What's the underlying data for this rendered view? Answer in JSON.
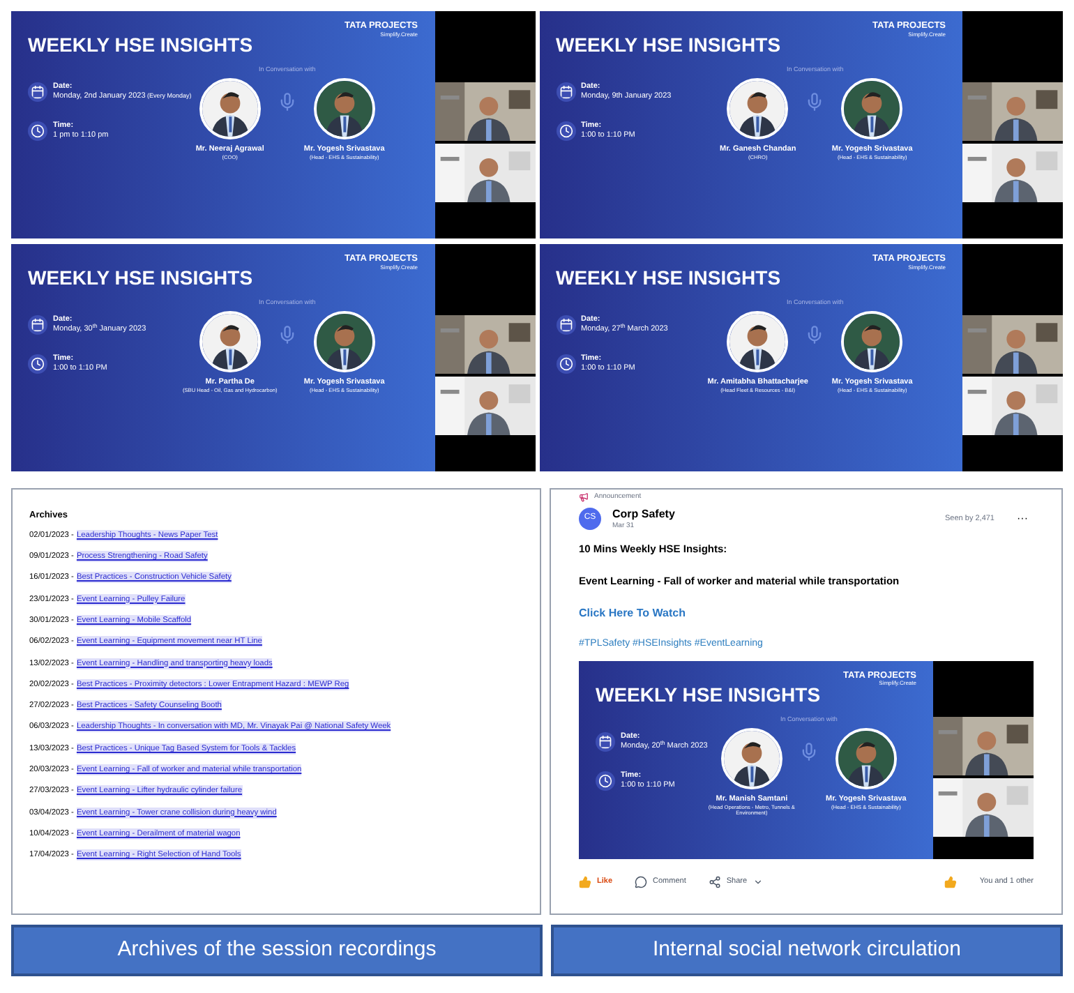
{
  "slides": [
    {
      "title": "WEEKLY HSE INSIGHTS",
      "logo": "TATA PROJECTS",
      "tagline": "Simplify.Create",
      "intro": "In Conversation with",
      "date_label": "Date:",
      "date": "Monday, 2nd January 2023",
      "date_note": "(Every Monday)",
      "time_label": "Time:",
      "time": "1 pm to 1:10 pm",
      "guests": [
        {
          "name": "Mr. Neeraj Agrawal",
          "role": "(COO)"
        },
        {
          "name": "Mr. Yogesh Srivastava",
          "role": "(Head - EHS & Sustainability)"
        }
      ]
    },
    {
      "title": "WEEKLY HSE INSIGHTS",
      "logo": "TATA PROJECTS",
      "tagline": "Simplify.Create",
      "intro": "In Conversation with",
      "date_label": "Date:",
      "date": "Monday, 9th January 2023",
      "time_label": "Time:",
      "time": "1:00 to 1:10 PM",
      "guests": [
        {
          "name": "Mr. Ganesh Chandan",
          "role": "(CHRO)"
        },
        {
          "name": "Mr. Yogesh Srivastava",
          "role": "(Head - EHS & Sustainability)"
        }
      ]
    },
    {
      "title": "WEEKLY HSE INSIGHTS",
      "logo": "TATA PROJECTS",
      "tagline": "Simplify.Create",
      "intro": "In Conversation with",
      "date_label": "Date:",
      "date": "Monday, 30$^{th}$ January 2023",
      "time_label": "Time:",
      "time": "1:00 to 1:10 PM",
      "guests": [
        {
          "name": "Mr. Partha De",
          "role": "(SBU Head - Oil, Gas and Hydrocarbon)"
        },
        {
          "name": "Mr. Yogesh Srivastava",
          "role": "(Head - EHS & Sustainability)"
        }
      ]
    },
    {
      "title": "WEEKLY HSE INSIGHTS",
      "logo": "TATA PROJECTS",
      "tagline": "Simplify.Create",
      "intro": "In Conversation with",
      "date_label": "Date:",
      "date": "Monday, 27$^{th}$ March 2023",
      "time_label": "Time:",
      "time": "1:00 to 1:10 PM",
      "guests": [
        {
          "name": "Mr. Amitabha Bhattacharjee",
          "role": "(Head Fleet & Resources - B&I)"
        },
        {
          "name": "Mr. Yogesh Srivastava",
          "role": "(Head - EHS & Sustainability)"
        }
      ]
    }
  ],
  "archives": {
    "title": "Archives",
    "items": [
      {
        "date": "02/01/2023 -",
        "link": "Leadership Thoughts - News Paper Test"
      },
      {
        "date": "09/01/2023 -",
        "link": "Process Strengthening - Road Safety"
      },
      {
        "date": "16/01/2023 -",
        "link": "Best Practices - Construction Vehicle Safety"
      },
      {
        "date": "23/01/2023 -",
        "link": "Event Learning - Pulley Failure"
      },
      {
        "date": "30/01/2023 -",
        "link": "Event Learning - Mobile Scaffold"
      },
      {
        "date": "06/02/2023 -",
        "link": "Event Learning - Equipment movement near HT Line"
      },
      {
        "date": "13/02/2023 -",
        "link": "Event Learning - Handling and transporting heavy loads"
      },
      {
        "date": "20/02/2023 -",
        "link": "Best Practices - Proximity detectors : Lower Entrapment Hazard : MEWP Reg"
      },
      {
        "date": "27/02/2023 -",
        "link": "Best Practices - Safety Counseling Booth"
      },
      {
        "date": "06/03/2023 -",
        "link": "Leadership Thoughts - In conversation with MD, Mr. Vinayak Pai @ National Safety Week"
      },
      {
        "date": "13/03/2023 -",
        "link": "Best Practices - Unique Tag Based System for Tools & Tackles"
      },
      {
        "date": "20/03/2023 -",
        "link": "Event Learning - Fall of worker and material while transportation"
      },
      {
        "date": "27/03/2023 -",
        "link": "Event Learning - Lifter hydraulic cylinder failure"
      },
      {
        "date": "03/04/2023 -",
        "link": "Event Learning - Tower crane collision during heavy wind"
      },
      {
        "date": "10/04/2023 -",
        "link": "Event Learning - Derailment of material wagon"
      },
      {
        "date": "17/04/2023 -",
        "link": "Event Learning - Right Selection of Hand Tools"
      }
    ]
  },
  "post": {
    "category": "Announcement",
    "initials": "CS",
    "author": "Corp Safety",
    "posted": "Mar 31",
    "seen": "Seen by 2,471",
    "more": "···",
    "heading": "10 Mins Weekly HSE Insights:",
    "subject": "Event Learning - Fall of worker and material while transportation",
    "link": "Click Here To Watch",
    "hashtags": "#TPLSafety #HSEInsights #EventLearning",
    "slide": {
      "title": "WEEKLY HSE INSIGHTS",
      "logo": "TATA PROJECTS",
      "tagline": "Simplify.Create",
      "intro": "In Conversation with",
      "date_label": "Date:",
      "date": "Monday, 20$^{th}$ March 2023",
      "time_label": "Time:",
      "time": "1:00 to 1:10 PM",
      "guests": [
        {
          "name": "Mr. Manish Samtani",
          "role": "(Head Operations - Metro, Tunnels & Environment)"
        },
        {
          "name": "Mr. Yogesh Srivastava",
          "role": "(Head - EHS & Sustainability)"
        }
      ]
    },
    "like": {
      "label": "Like",
      "active": true
    },
    "comment": "Comment",
    "share": "Share",
    "reactions": "You and 1 other"
  },
  "captions": [
    "Archives of the session recordings",
    "Internal social network circulation"
  ]
}
